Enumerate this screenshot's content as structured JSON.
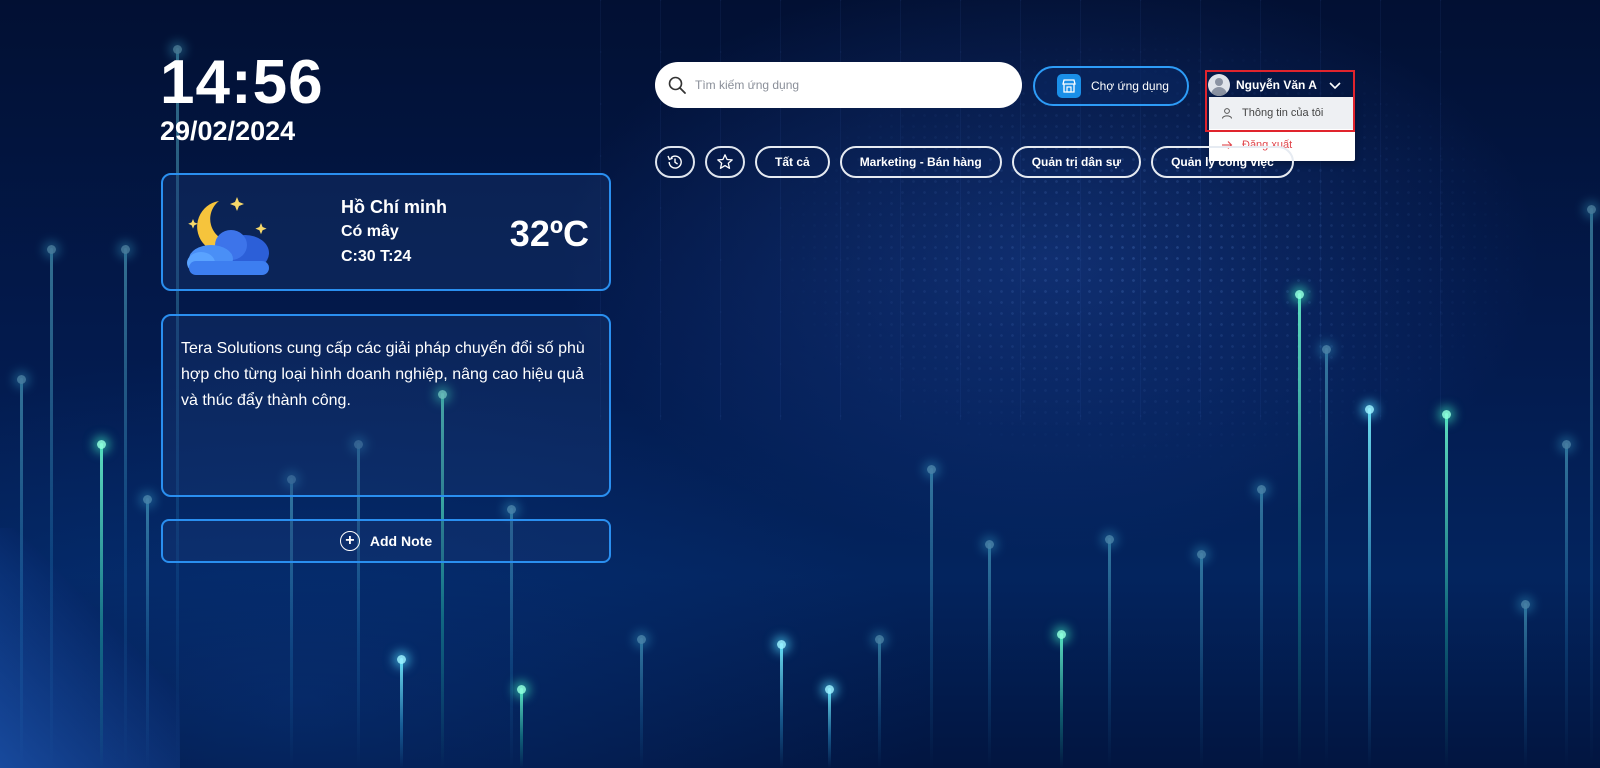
{
  "clock": {
    "time": "14:56",
    "date": "29/02/2024"
  },
  "weather": {
    "city": "Hồ Chí minh",
    "condition": "Có mây",
    "range": "C:30 T:24",
    "temperature": "32ºC",
    "icon": "moon-cloud-icon"
  },
  "note": {
    "text": "Tera Solutions cung cấp các giải pháp chuyển đổi số phù hợp cho từng loại hình doanh nghiệp, nâng cao hiệu quả và thúc đẩy thành công."
  },
  "add_note": {
    "label": "Add Note"
  },
  "search": {
    "placeholder": "Tìm kiếm ứng dụng",
    "value": ""
  },
  "market": {
    "label": "Chợ ứng dụng"
  },
  "user": {
    "name": "Nguyễn Văn A",
    "menu": [
      {
        "label": "Thông tin của tôi",
        "icon": "user-icon"
      },
      {
        "label": "Đăng xuất",
        "icon": "logout-arrow-icon"
      }
    ]
  },
  "filters": {
    "icon_chips": [
      "history-icon",
      "star-icon"
    ],
    "chips": [
      "Tất cả",
      "Marketing - Bán hàng",
      "Quản trị dân sự",
      "Quản lý công việc"
    ]
  },
  "colors": {
    "accent_border": "#2a8ff0",
    "highlight_box": "#e0242d",
    "logout_text": "#e0464c"
  }
}
